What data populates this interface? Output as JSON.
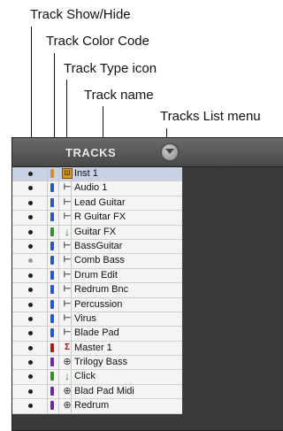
{
  "callouts": {
    "show_hide": "Track Show/Hide",
    "color_code": "Track Color Code",
    "type_icon": "Track Type icon",
    "track_name": "Track name",
    "list_menu": "Tracks List menu"
  },
  "panel": {
    "title": "TRACKS"
  },
  "tracks": [
    {
      "name": "Inst 1",
      "color": "#d0902a",
      "icon": "instrument-track-icon",
      "glyph": "Ш",
      "shown": true,
      "selected": true
    },
    {
      "name": "Audio 1",
      "color": "#2a55c8",
      "icon": "audio-track-icon",
      "glyph": "⊢",
      "shown": true
    },
    {
      "name": "Lead Guitar",
      "color": "#2a55c8",
      "icon": "audio-track-icon",
      "glyph": "⊢",
      "shown": true
    },
    {
      "name": "R Guitar FX",
      "color": "#2a55c8",
      "icon": "audio-track-icon",
      "glyph": "⊢",
      "shown": true
    },
    {
      "name": "Guitar FX",
      "color": "#3a8a2a",
      "icon": "aux-input-icon",
      "glyph": "↓",
      "shown": true
    },
    {
      "name": "BassGuitar",
      "color": "#2a55c8",
      "icon": "audio-track-icon",
      "glyph": "⊢",
      "shown": true
    },
    {
      "name": "Comb Bass",
      "color": "#2a55c8",
      "icon": "audio-track-icon",
      "glyph": "⊢",
      "shown": false
    },
    {
      "name": "Drum Edit",
      "color": "#2a55c8",
      "icon": "audio-track-icon",
      "glyph": "⊢",
      "shown": true
    },
    {
      "name": "Redrum Bnc",
      "color": "#2a55c8",
      "icon": "audio-track-icon",
      "glyph": "⊢",
      "shown": true
    },
    {
      "name": "Percussion",
      "color": "#2a55c8",
      "icon": "audio-track-icon",
      "glyph": "⊢",
      "shown": true
    },
    {
      "name": "Virus",
      "color": "#2a55c8",
      "icon": "audio-track-icon",
      "glyph": "⊢",
      "shown": true
    },
    {
      "name": "Blade Pad",
      "color": "#2a55c8",
      "icon": "audio-track-icon",
      "glyph": "⊢",
      "shown": true
    },
    {
      "name": "Master 1",
      "color": "#b01818",
      "icon": "master-fader-icon",
      "glyph": "Σ",
      "shown": true
    },
    {
      "name": "Trilogy Bass",
      "color": "#6a2aa8",
      "icon": "midi-track-icon",
      "glyph": "⊕",
      "shown": true
    },
    {
      "name": "Click",
      "color": "#3a8a2a",
      "icon": "aux-input-icon",
      "glyph": "↓",
      "shown": true
    },
    {
      "name": "Blad Pad Midi",
      "color": "#6a2aa8",
      "icon": "midi-track-icon",
      "glyph": "⊕",
      "shown": true
    },
    {
      "name": "Redrum",
      "color": "#6a2aa8",
      "icon": "midi-track-icon",
      "glyph": "⊕",
      "shown": true
    }
  ]
}
